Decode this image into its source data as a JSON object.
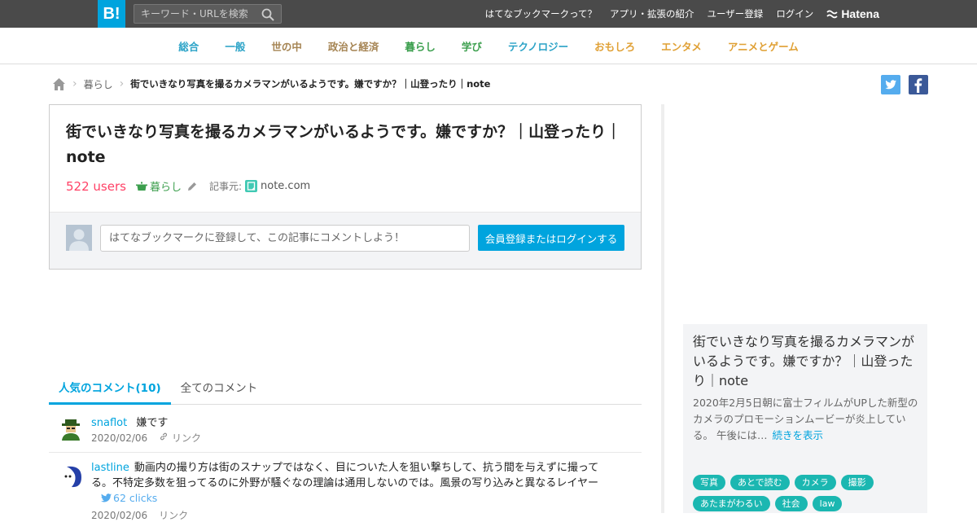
{
  "header": {
    "logo": "B!",
    "search_placeholder": "キーワード・URLを検索",
    "nav": [
      "はてなブックマークって？",
      "アプリ・拡張の紹介",
      "ユーザー登録",
      "ログイン"
    ],
    "brand": "Hatena"
  },
  "categories": [
    {
      "label": "総合",
      "color": "#2ba3c7"
    },
    {
      "label": "一般",
      "color": "#2ba3c7"
    },
    {
      "label": "世の中",
      "color": "#a58453"
    },
    {
      "label": "政治と経済",
      "color": "#a58453"
    },
    {
      "label": "暮らし",
      "color": "#3c9f4e"
    },
    {
      "label": "学び",
      "color": "#3c9f4e"
    },
    {
      "label": "テクノロジー",
      "color": "#2ba3c7"
    },
    {
      "label": "おもしろ",
      "color": "#e0a034"
    },
    {
      "label": "エンタメ",
      "color": "#e0a034"
    },
    {
      "label": "アニメとゲーム",
      "color": "#e0a034"
    }
  ],
  "breadcrumb": {
    "category": "暮らし",
    "current": "街でいきなり写真を撮るカメラマンがいるようです。嫌ですか？｜山登ったり｜note"
  },
  "entry": {
    "title": "街でいきなり写真を撮るカメラマンがいるようです。嫌ですか？｜山登ったり｜note",
    "users": "522 users",
    "category": "暮らし",
    "source_label": "記事元:",
    "source": "note.com",
    "comment_placeholder": "はてなブックマークに登録して、この記事にコメントしよう！",
    "login_button": "会員登録またはログインする"
  },
  "tabs": {
    "popular": "人気のコメント(10)",
    "all": "全てのコメント"
  },
  "comments": [
    {
      "user": "snaflot",
      "text": "嫌です",
      "date": "2020/02/06",
      "link": "リンク"
    },
    {
      "user": "lastline",
      "text": "動画内の撮り方は街のスナップではなく、目についた人を狙い撃ちして、抗う間を与えずに撮って",
      "text2": "る。不特定多数を狙ってるのに外野が騒ぐなの理論は通用しないのでは。風景の写り込みと異なるレイヤー",
      "clicks": "62 clicks",
      "date": "2020/02/06",
      "link": "リンク"
    }
  ],
  "sidebar": {
    "title": "街でいきなり写真を撮るカメラマンがいるようです。嫌ですか？｜山登ったり｜note",
    "desc": "2020年2月5日朝に富士フィルムがUPした新型のカメラのプロモーションムービーが炎上している。 午後には…",
    "more": "続きを表示",
    "tags": [
      "写真",
      "あとで読む",
      "カメラ",
      "撮影",
      "あたまがわるい",
      "社会",
      "law"
    ]
  },
  "colors": {
    "accent": "#00a4de",
    "users": "#ff4166",
    "tag": "#1bb7b1",
    "twitter": "#55acee",
    "facebook": "#3b5998"
  }
}
